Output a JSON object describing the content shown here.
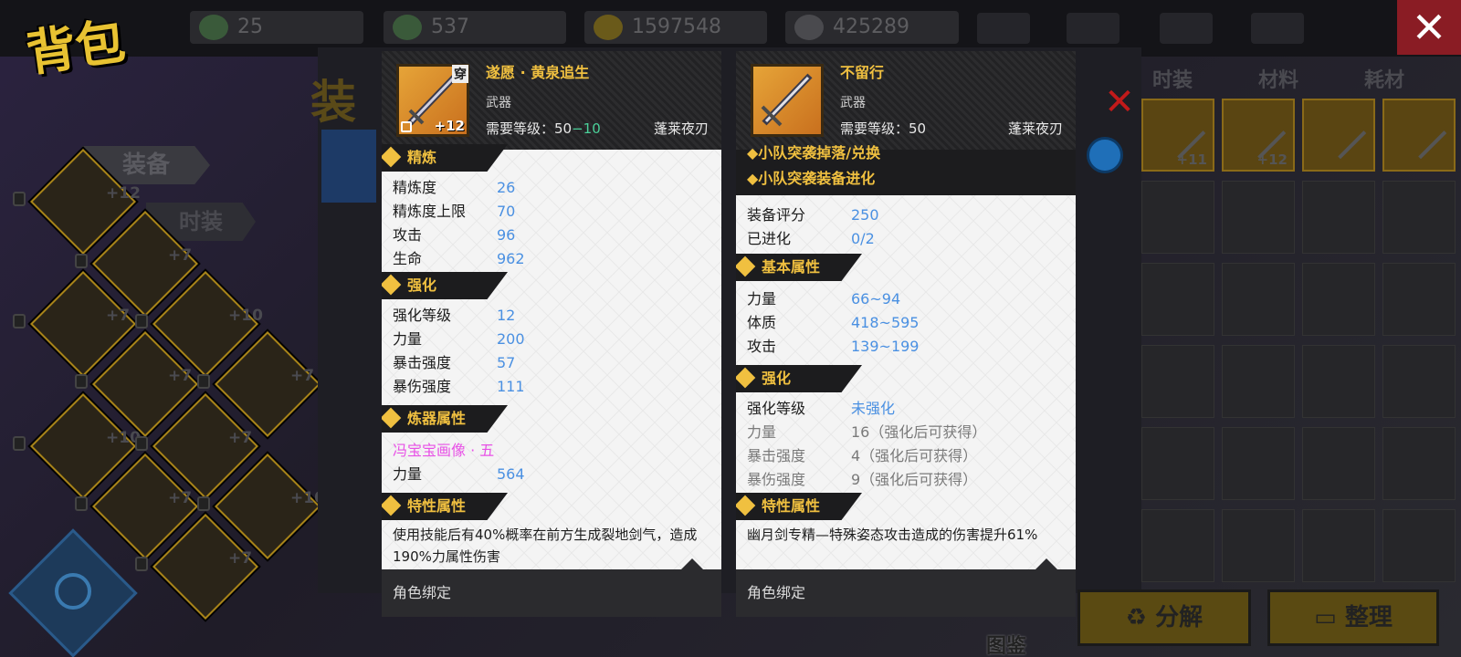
{
  "header": {
    "title": "背包",
    "currencies": [
      {
        "icon": "ticket-icon",
        "value": "25"
      },
      {
        "icon": "ticket-bundle-icon",
        "value": "537"
      },
      {
        "icon": "gold-coin-icon",
        "value": "1597548"
      },
      {
        "icon": "silver-coin-icon",
        "value": "425289"
      }
    ]
  },
  "side_tabs": {
    "equipment": "装备",
    "fashion": "时装"
  },
  "back_panel": {
    "title": "装"
  },
  "right_tabs": [
    "时装",
    "材料",
    "耗材"
  ],
  "right_grid_items": [
    {
      "icon": "sword-icon",
      "plus": ""
    },
    {
      "icon": "sword-icon",
      "plus": "+11"
    },
    {
      "icon": "sword-icon",
      "plus": "+12"
    },
    {
      "icon": "necklace-icon",
      "plus": ""
    },
    {
      "icon": "bracer-icon",
      "plus": ""
    }
  ],
  "left_items": [
    {
      "plus": "+12"
    },
    {
      "plus": "+7"
    },
    {
      "plus": "+7"
    },
    {
      "plus": "+10"
    },
    {
      "plus": "+7"
    },
    {
      "plus": "+7"
    },
    {
      "plus": "+10"
    },
    {
      "plus": "+7"
    },
    {
      "plus": "+7"
    },
    {
      "plus": "+10"
    },
    {
      "plus": "+7"
    }
  ],
  "buttons": {
    "decompose": "分解",
    "organize": "整理",
    "atlas": "图鉴"
  },
  "card_left": {
    "name": "遂愿 · 黄泉追生",
    "badge": "穿",
    "plus": "+12",
    "type": "武器",
    "req_label": "需要等级：",
    "req_level": "50",
    "req_bonus": "−10",
    "owner": "蓬莱夜刃",
    "sec_refine": "精炼",
    "refine_rows": [
      {
        "label": "精炼度",
        "value": "26"
      },
      {
        "label": "精炼度上限",
        "value": "70"
      },
      {
        "label": "攻击",
        "value": "96"
      },
      {
        "label": "生命",
        "value": "962"
      }
    ],
    "sec_enhance": "强化",
    "enhance_rows": [
      {
        "label": "强化等级",
        "value": "12"
      },
      {
        "label": "力量",
        "value": "200"
      },
      {
        "label": "暴击强度",
        "value": "57"
      },
      {
        "label": "暴伤强度",
        "value": "111"
      }
    ],
    "sec_forge": "炼器属性",
    "forge_name": "冯宝宝画像 · 五",
    "forge_rows": [
      {
        "label": "力量",
        "value": "564"
      }
    ],
    "sec_trait": "特性属性",
    "trait_desc": "使用技能后有40%概率在前方生成裂地剑气，造成190%力属性伤害",
    "footer": "角色绑定"
  },
  "card_right": {
    "name": "不留行",
    "type": "武器",
    "req_label": "需要等级：",
    "req_level": "50",
    "owner": "蓬莱夜刃",
    "notice1": "◆小队突袭掉落/兑换",
    "notice2": "◆小队突袭装备进化",
    "top_rows": [
      {
        "label": "装备评分",
        "value": "250"
      },
      {
        "label": "已进化",
        "value": "0/2"
      }
    ],
    "sec_base": "基本属性",
    "base_rows": [
      {
        "label": "力量",
        "value": "66~94"
      },
      {
        "label": "体质",
        "value": "418~595"
      },
      {
        "label": "攻击",
        "value": "139~199"
      }
    ],
    "sec_enhance": "强化",
    "enhance_level_label": "强化等级",
    "enhance_level_value": "未强化",
    "enhance_rows": [
      {
        "label": "力量",
        "value": "16（强化后可获得）"
      },
      {
        "label": "暴击强度",
        "value": "4（强化后可获得）"
      },
      {
        "label": "暴伤强度",
        "value": "9（强化后可获得）"
      }
    ],
    "sec_trait": "特性属性",
    "trait_desc": "幽月剑专精—特殊姿态攻击造成的伤害提升61%",
    "footer": "角色绑定"
  },
  "colors": {
    "accent_gold": "#f0c040",
    "value_blue": "#4a90e2",
    "level_bonus_green": "#4bd19a",
    "forge_pink": "#e850e6",
    "close_red": "#c21a1a"
  }
}
